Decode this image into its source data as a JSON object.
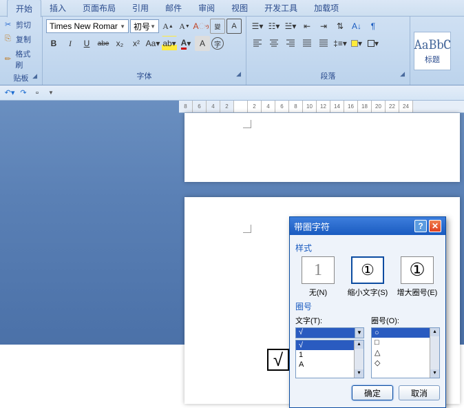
{
  "tabs": [
    "开始",
    "插入",
    "页面布局",
    "引用",
    "邮件",
    "审阅",
    "视图",
    "开发工具",
    "加载项"
  ],
  "active_tab": 0,
  "clipboard": {
    "title": "贴板",
    "cut": "剪切",
    "copy": "复制",
    "brush": "格式刷"
  },
  "font_group": {
    "title": "字体",
    "family": "Times New Romar",
    "size": "初号",
    "bold": "B",
    "italic": "I",
    "underline": "U",
    "strike": "abe",
    "sub": "x₂",
    "sup": "x²"
  },
  "para_group": {
    "title": "段落"
  },
  "style_group": {
    "sample": "AaBbC",
    "label": "标题"
  },
  "ruler_ticks": [
    "8",
    "6",
    "4",
    "2",
    "",
    "2",
    "4",
    "6",
    "8",
    "10",
    "12",
    "14",
    "16",
    "18",
    "20",
    "22",
    "24"
  ],
  "page2_mark": "√",
  "dialog": {
    "title": "带圈字符",
    "section_style": "样式",
    "styles": [
      {
        "glyph": "1",
        "label": "无(N)"
      },
      {
        "glyph": "①",
        "label": "缩小文字(S)"
      },
      {
        "glyph": "①",
        "label": "增大圈号(E)"
      }
    ],
    "selected_style": 1,
    "section_enc": "圈号",
    "text_label": "文字(T):",
    "enc_label": "圈号(O):",
    "text_value": "√",
    "text_items": [
      "√",
      "1",
      "A"
    ],
    "enc_items": [
      "○",
      "□",
      "△",
      "◇"
    ],
    "enc_selected": "○",
    "ok": "确定",
    "cancel": "取消"
  }
}
